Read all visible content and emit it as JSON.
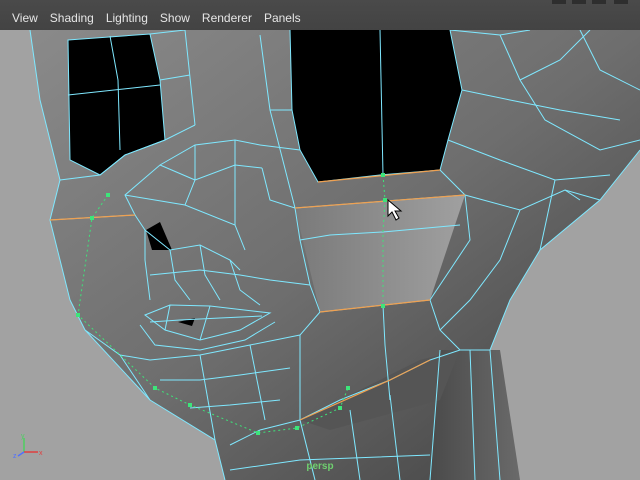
{
  "menubar": {
    "items": [
      {
        "id": "view",
        "label": "View"
      },
      {
        "id": "shading",
        "label": "Shading"
      },
      {
        "id": "lighting",
        "label": "Lighting"
      },
      {
        "id": "show",
        "label": "Show"
      },
      {
        "id": "renderer",
        "label": "Renderer"
      },
      {
        "id": "panels",
        "label": "Panels"
      }
    ]
  },
  "viewport": {
    "camera_label": "persp",
    "background_color": "#a2a2a2",
    "wire_color": "#7fe8ff",
    "selected_edge_color": "#f0a050",
    "vertex_color": "#3de57a"
  },
  "axis_gizmo": {
    "x_label": "x",
    "y_label": "y",
    "z_label": "z"
  }
}
